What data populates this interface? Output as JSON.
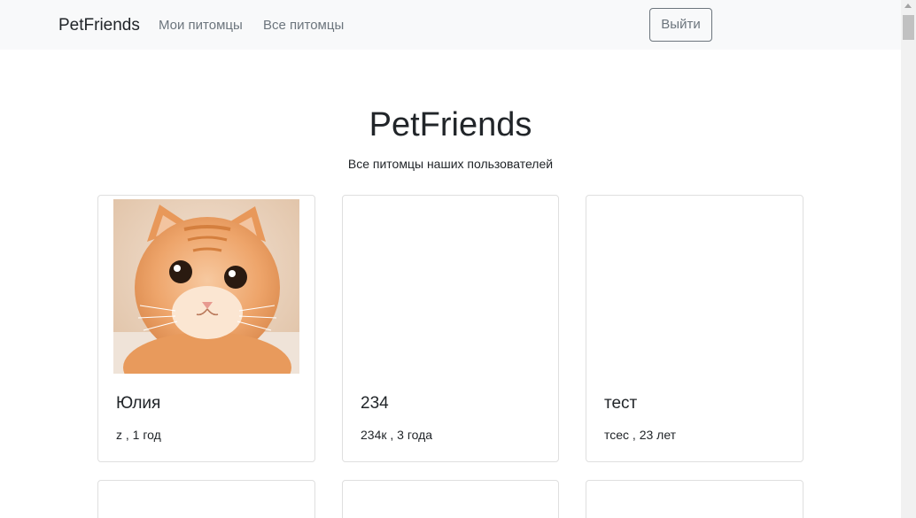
{
  "navbar": {
    "brand": "PetFriends",
    "links": [
      "Мои питомцы",
      "Все питомцы"
    ],
    "logout_label": "Выйти"
  },
  "header": {
    "title": "PetFriends",
    "subtitle": "Все питомцы наших пользователей"
  },
  "pets": [
    {
      "name": "Юлия",
      "info": "z , 1 год",
      "photo": "orange-kitten-photo"
    },
    {
      "name": "234",
      "info": "234к , 3 года"
    },
    {
      "name": "тест",
      "info": "тсес , 23 лет"
    }
  ],
  "colors": {
    "navbar_bg": "#f8f9fa",
    "link": "#6c757d",
    "text": "#212529",
    "card_border": "#dfdfdf"
  }
}
